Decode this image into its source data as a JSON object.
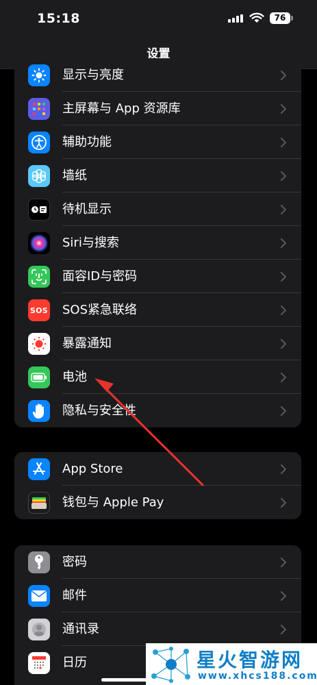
{
  "status": {
    "time": "15:18",
    "battery": "76"
  },
  "nav": {
    "title": "设置"
  },
  "groups": [
    {
      "items": [
        {
          "label": "显示与亮度",
          "icon": "sun-icon",
          "color": "#0a84ff"
        },
        {
          "label": "主屏幕与 App 资源库",
          "icon": "home-screen-grid-icon",
          "color": "#5e5ce6"
        },
        {
          "label": "辅助功能",
          "icon": "accessibility-icon",
          "color": "#0a84ff"
        },
        {
          "label": "墙纸",
          "icon": "flower-icon",
          "color": "#5ac8fa"
        },
        {
          "label": "待机显示",
          "icon": "standby-icon",
          "color": "#1c1c1e"
        },
        {
          "label": "Siri与搜索",
          "icon": "siri-icon",
          "color": "#2c2c2e"
        },
        {
          "label": "面容ID与密码",
          "icon": "face-id-icon",
          "color": "#34c759"
        },
        {
          "label": "SOS紧急联络",
          "icon": "sos-icon",
          "color": "#ff3b30"
        },
        {
          "label": "暴露通知",
          "icon": "exposure-icon",
          "color": "#ffffff"
        },
        {
          "label": "电池",
          "icon": "battery-icon",
          "color": "#34c759"
        },
        {
          "label": "隐私与安全性",
          "icon": "hand-icon",
          "color": "#0a84ff"
        }
      ]
    },
    {
      "items": [
        {
          "label": "App Store",
          "icon": "app-store-icon",
          "color": "#0a84ff"
        },
        {
          "label": "钱包与 Apple Pay",
          "icon": "wallet-icon",
          "color": "#1c1c1e"
        }
      ]
    },
    {
      "items": [
        {
          "label": "密码",
          "icon": "key-icon",
          "color": "#8e8e93"
        },
        {
          "label": "邮件",
          "icon": "mail-icon",
          "color": "#0a84ff"
        },
        {
          "label": "通讯录",
          "icon": "contacts-icon",
          "color": "#c7c7cc"
        },
        {
          "label": "日历",
          "icon": "calendar-icon",
          "color": "#ffffff"
        }
      ]
    }
  ],
  "icons": {
    "sos_text": "SOS"
  },
  "watermark": {
    "title": "星火智游网",
    "url": "www.xhcs188.com"
  },
  "accent_arrow_color": "#e8332c"
}
